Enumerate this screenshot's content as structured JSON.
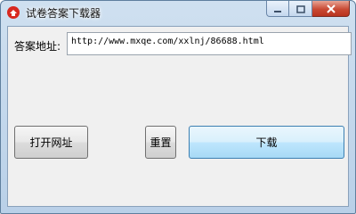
{
  "window": {
    "title": "试卷答案下载器"
  },
  "form": {
    "url_label": "答案地址:",
    "url_value": "http://www.mxqe.com/xxlnj/86688.html"
  },
  "buttons": {
    "open_url": "打开网址",
    "reset": "重置",
    "download": "下载"
  },
  "colors": {
    "close_button": "#c94a34",
    "download_button": "#bee6fd"
  },
  "icons": {
    "app": "app-icon",
    "minimize": "minimize-icon",
    "maximize": "maximize-icon",
    "close": "close-icon"
  }
}
